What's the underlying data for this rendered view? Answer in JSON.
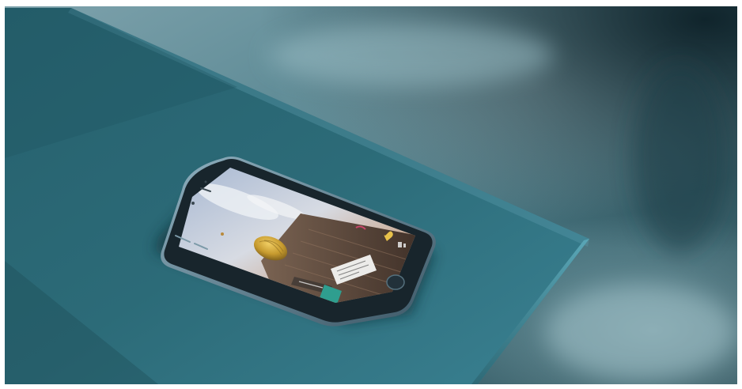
{
  "scene": {
    "subject": "smartphone",
    "palette": {
      "background_dark": "#0e2a33",
      "background_mid": "#3f6a74",
      "background_light": "#8fb3bb",
      "table_top": "#2f6673",
      "table_shadow": "#1d4550",
      "table_edge": "#5aa3b3",
      "phone_body": "#1b2a33",
      "phone_rim": "#6b8a98",
      "sky": "#b9c9de",
      "ground": "#5a4638",
      "balloon": "#c9a33a",
      "chat_box": "#f2f2f0",
      "accent": "#2f9e8f"
    },
    "icons": [
      "hot-air-balloon-icon",
      "heart-icon",
      "home-button-icon",
      "speaker-icon",
      "camera-icon"
    ]
  },
  "screen": {
    "chat": {
      "username": "",
      "message": ""
    }
  }
}
